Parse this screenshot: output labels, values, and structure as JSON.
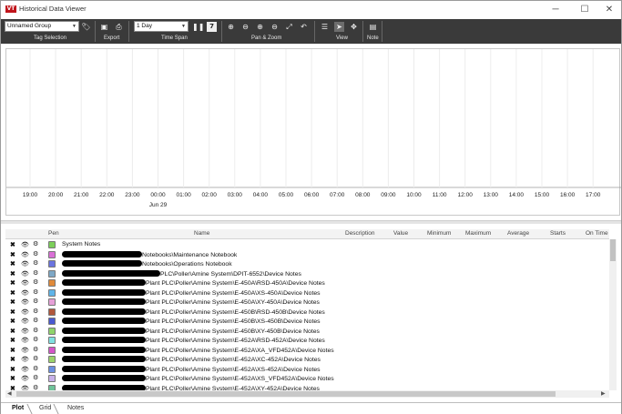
{
  "window": {
    "logo": "VT",
    "title": "Historical Data Viewer",
    "minimize_glyph": "─",
    "maximize_glyph": "☐",
    "close_glyph": "✕"
  },
  "ribbon": {
    "tag_group_select": "Unnamed Group",
    "time_span_select": "1 Day",
    "groups": {
      "tag_selection": "Tag Selection",
      "export": "Export",
      "time_span": "Time Span",
      "pan_zoom": "Pan & Zoom",
      "view": "View",
      "note": "Note"
    },
    "icons": {
      "tag": "tag-icon",
      "save": "save-icon",
      "print": "print-icon",
      "pause": "pause-icon",
      "calendar": "calendar-icon",
      "zoom_in": "zoom-in-icon",
      "zoom_out": "zoom-out-icon",
      "zoom_in_x": "zoom-in-x-icon",
      "zoom_out_x": "zoom-out-x-icon",
      "zoom_fit": "zoom-fit-icon",
      "undo": "undo-icon",
      "view_list": "view-list-icon",
      "pointer": "pointer-icon",
      "pan": "pan-icon",
      "note": "note-icon"
    },
    "calendar_day": "7"
  },
  "chart_data": {
    "type": "line",
    "x": [
      "19:00",
      "20:00",
      "21:00",
      "22:00",
      "23:00",
      "00:00",
      "01:00",
      "02:00",
      "03:00",
      "04:00",
      "05:00",
      "06:00",
      "07:00",
      "08:00",
      "09:00",
      "10:00",
      "11:00",
      "12:00",
      "13:00",
      "14:00",
      "15:00",
      "16:00",
      "17:00"
    ],
    "date_label": "Jun 29",
    "series": [],
    "grid": true
  },
  "table": {
    "columns": {
      "pen": "Pen",
      "name": "Name",
      "description": "Description",
      "value": "Value",
      "minimum": "Minimum",
      "maximum": "Maximum",
      "average": "Average",
      "starts": "Starts",
      "on_time": "On Time"
    },
    "row_icons": {
      "remove": "✖",
      "visible": "👁",
      "settings": "⚙"
    },
    "rows": [
      {
        "name": "System Notes",
        "redacted": false,
        "pen_color": "#7ccf5a"
      },
      {
        "name": "Notebooks\\Maintenance Notebook",
        "redacted": true,
        "pen_color": "#d96fd6"
      },
      {
        "name": "Notebooks\\Operations Notebook",
        "redacted": true,
        "pen_color": "#6a74e0"
      },
      {
        "name": "PLC\\Poller\\Amine System\\DPIT-6552\\Device Notes",
        "redacted": true,
        "pen_color": "#7da7c6"
      },
      {
        "name": "Plant PLC\\Poller\\Amine System\\E-450A\\RSD-450A\\Device Notes",
        "redacted": true,
        "pen_color": "#e08a3a"
      },
      {
        "name": "Plant PLC\\Poller\\Amine System\\E-450A\\XS-450A\\Device Notes",
        "redacted": true,
        "pen_color": "#5fb4e8"
      },
      {
        "name": "Plant PLC\\Poller\\Amine System\\E-450A\\XY-450A\\Device Notes",
        "redacted": true,
        "pen_color": "#e6a0d8"
      },
      {
        "name": "Plant PLC\\Poller\\Amine System\\E-450B\\RSD-450B\\Device Notes",
        "redacted": true,
        "pen_color": "#b0573c"
      },
      {
        "name": "Plant PLC\\Poller\\Amine System\\E-450B\\XS-450B\\Device Notes",
        "redacted": true,
        "pen_color": "#4a5ad0"
      },
      {
        "name": "Plant PLC\\Poller\\Amine System\\E-450B\\XY-450B\\Device Notes",
        "redacted": true,
        "pen_color": "#8fd46a"
      },
      {
        "name": "Plant PLC\\Poller\\Amine System\\E-452A\\RSD-452A\\Device Notes",
        "redacted": true,
        "pen_color": "#7fe0e0"
      },
      {
        "name": "Plant PLC\\Poller\\Amine System\\E-452A\\XA_VFD452A\\Device Notes",
        "redacted": true,
        "pen_color": "#d455c8"
      },
      {
        "name": "Plant PLC\\Poller\\Amine System\\E-452A\\XC-452A\\Device Notes",
        "redacted": true,
        "pen_color": "#9ad26a"
      },
      {
        "name": "Plant PLC\\Poller\\Amine System\\E-452A\\XS-452A\\Device Notes",
        "redacted": true,
        "pen_color": "#6a8fe0"
      },
      {
        "name": "Plant PLC\\Poller\\Amine System\\E-452A\\XS_VFD452A\\Device Notes",
        "redacted": true,
        "pen_color": "#c7b0e8"
      },
      {
        "name": "Plant PLC\\Poller\\Amine System\\E-452A\\XY-452A\\Device Notes",
        "redacted": true,
        "pen_color": "#6fc39a"
      }
    ]
  },
  "tabs": [
    "Plot",
    "Grid",
    "Notes"
  ]
}
